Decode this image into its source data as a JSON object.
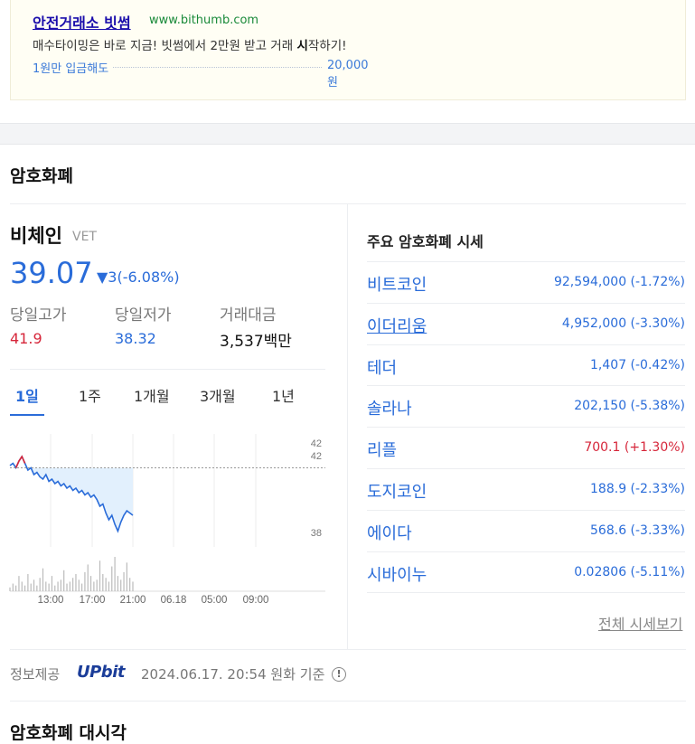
{
  "ad": {
    "title": "안전거래소 빗썸",
    "url": "www.bithumb.com",
    "desc_pre": "매수타이밍은 바로 지금! 빗썸에서 2만원 받고 거래 ",
    "desc_bold": "시",
    "desc_post": "작하기!",
    "line_label": "1원만 입금해도",
    "line_amount": "20,000원"
  },
  "section_title": "암호화폐",
  "coin": {
    "name": "비체인",
    "symbol": "VET",
    "price": "39.07",
    "change": "▼3(-6.08%)",
    "stats": [
      {
        "label": "당일고가",
        "value": "41.9",
        "color": "#d6263a"
      },
      {
        "label": "당일저가",
        "value": "38.32",
        "color": "#2a6cd9"
      },
      {
        "label": "거래대금",
        "value": "3,537백만",
        "color": "#111111"
      }
    ]
  },
  "tabs": [
    "1일",
    "1주",
    "1개월",
    "3개월",
    "1년"
  ],
  "active_tab": "1일",
  "chart_data": {
    "type": "line",
    "x_ticks": [
      "13:00",
      "17:00",
      "21:00",
      "06.18",
      "05:00",
      "09:00"
    ],
    "y_ticks": [
      "42",
      "42",
      "38"
    ],
    "ylim": [
      37.5,
      42.5
    ],
    "price_series": [
      41.1,
      41.2,
      41.0,
      41.3,
      41.5,
      41.2,
      40.9,
      41.0,
      40.7,
      40.8,
      40.6,
      40.5,
      40.7,
      40.4,
      40.5,
      40.3,
      40.4,
      40.2,
      40.3,
      40.1,
      40.2,
      40.0,
      40.1,
      39.9,
      40.0,
      39.8,
      39.9,
      39.7,
      39.8,
      39.6,
      39.3,
      39.4,
      39.0,
      38.7,
      38.9,
      38.5,
      38.2,
      38.6,
      38.9,
      39.1,
      39.0,
      38.9
    ],
    "volume_series": [
      2,
      4,
      3,
      8,
      5,
      3,
      9,
      4,
      6,
      3,
      7,
      12,
      5,
      4,
      8,
      3,
      5,
      6,
      11,
      4,
      5,
      7,
      9,
      6,
      4,
      10,
      14,
      8,
      5,
      6,
      16,
      9,
      7,
      5,
      13,
      18,
      8,
      6,
      10,
      15,
      7,
      5
    ]
  },
  "market": {
    "title": "주요 암호화폐 시세",
    "rows": [
      {
        "name": "비트코인",
        "value": "92,594,000 (-1.72%)",
        "dir": "down",
        "underline": false
      },
      {
        "name": "이더리움",
        "value": "4,952,000 (-3.30%)",
        "dir": "down",
        "underline": true
      },
      {
        "name": "테더",
        "value": "1,407 (-0.42%)",
        "dir": "down",
        "underline": false
      },
      {
        "name": "솔라나",
        "value": "202,150 (-5.38%)",
        "dir": "down",
        "underline": false
      },
      {
        "name": "리플",
        "value": "700.1 (+1.30%)",
        "dir": "up",
        "underline": false
      },
      {
        "name": "도지코인",
        "value": "188.9 (-2.33%)",
        "dir": "down",
        "underline": false
      },
      {
        "name": "에이다",
        "value": "568.6 (-3.33%)",
        "dir": "down",
        "underline": false
      },
      {
        "name": "시바이누",
        "value": "0.02806 (-5.11%)",
        "dir": "down",
        "underline": false
      }
    ],
    "more_label": "전체 시세보기"
  },
  "footer": {
    "provider_label": "정보제공",
    "provider_logo": "UPbit",
    "timestamp": "2024.06.17. 20:54 원화 기준",
    "info_icon": "!"
  },
  "next_section_title": "암호화폐 대시각"
}
